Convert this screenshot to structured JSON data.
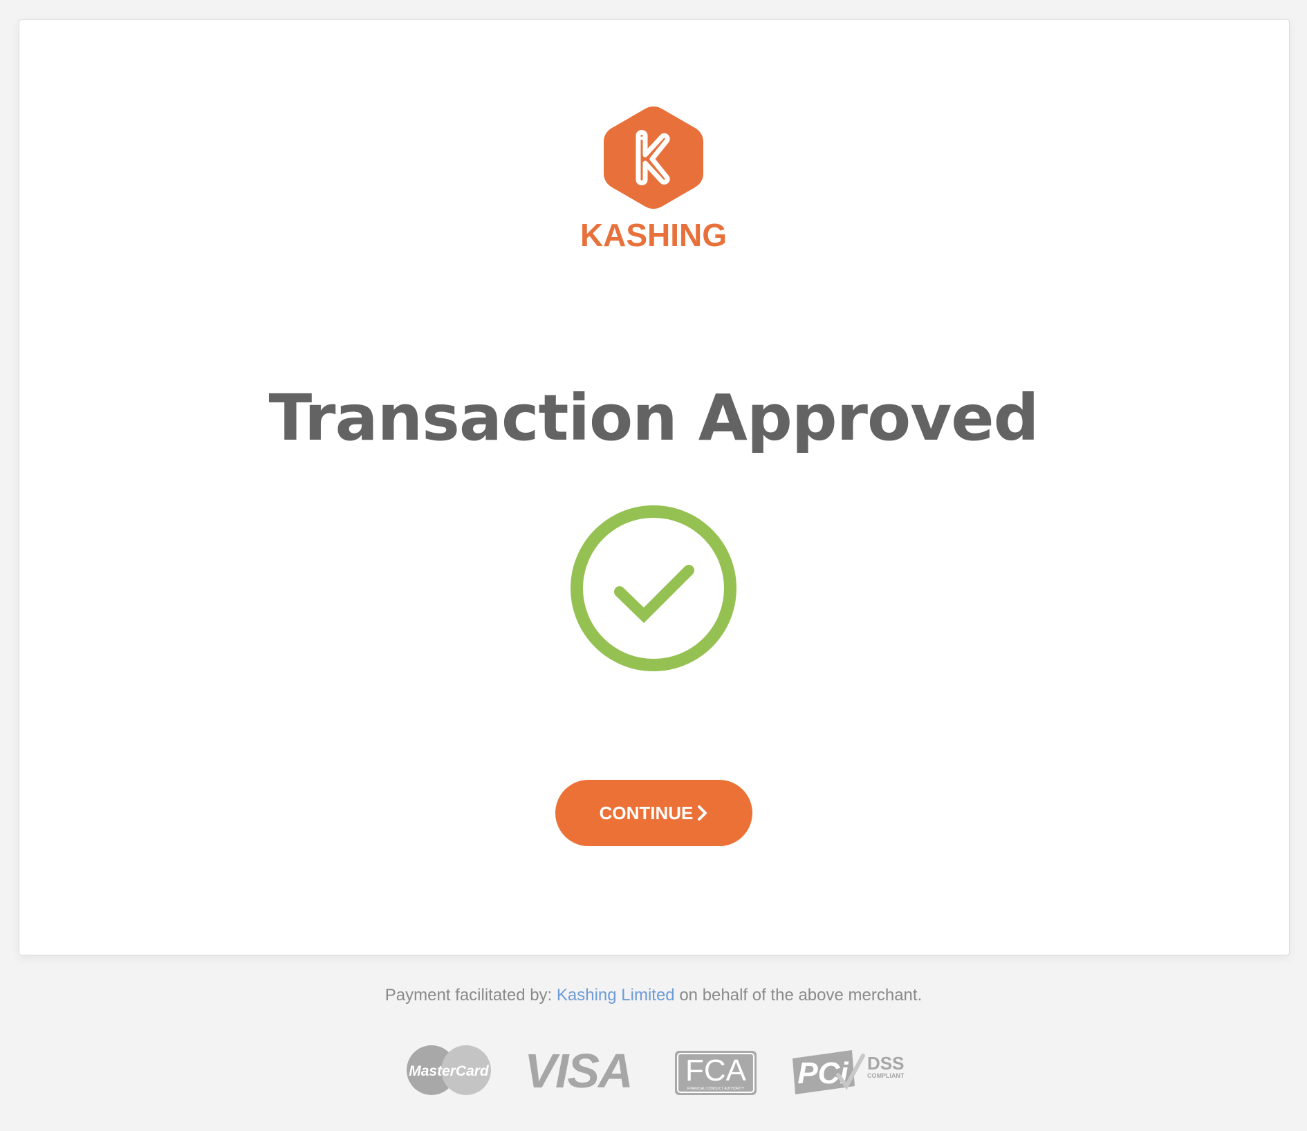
{
  "brand": {
    "logo_letter": "K",
    "name": "KASHING",
    "color": "#e8703a"
  },
  "main": {
    "title": "Transaction Approved",
    "status_icon": "check-circle-icon",
    "status_color": "#95c152"
  },
  "actions": {
    "continue_label": "CONTINUE",
    "continue_icon": "chevron-right-icon",
    "button_color": "#eb7137"
  },
  "footer": {
    "prefix": "Payment facilitated by: ",
    "link_text": "Kashing Limited",
    "suffix": " on behalf of the above merchant.",
    "link_color": "#6e9bd6"
  },
  "badges": {
    "mastercard": "MasterCard",
    "visa": "VISA",
    "fca": "FCA",
    "fca_sub": "FINANCIAL CONDUCT AUTHORITY",
    "pci": "PCi",
    "pci_dss": "DSS",
    "pci_compliant": "COMPLIANT"
  }
}
